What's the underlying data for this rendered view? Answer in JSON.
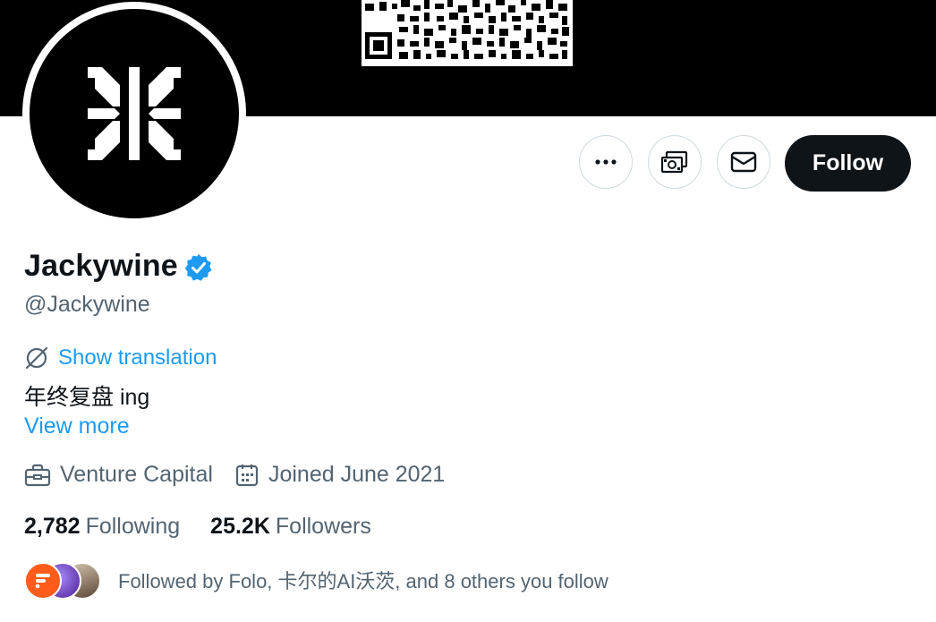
{
  "profile": {
    "display_name": "Jackywine",
    "handle": "@Jackywine",
    "verified_icon": "verified-badge-icon",
    "translate_label": "Show translation",
    "bio": "年终复盘 ing",
    "view_more": "View more",
    "category": "Venture Capital",
    "joined": "Joined June 2021",
    "following_count": "2,782",
    "following_label": "Following",
    "followers_count": "25.2K",
    "followers_label": "Followers",
    "followed_by": "Followed by Folo, 卡尔的AI沃茨, and 8 others you follow"
  },
  "actions": {
    "more_icon": "more-icon",
    "subscribe_icon": "money-icon",
    "message_icon": "mail-icon",
    "follow_label": "Follow"
  },
  "colors": {
    "accent": "#1d9bf0",
    "text": "#0f1419",
    "muted": "#536471",
    "follow_bg": "#0f1419"
  }
}
